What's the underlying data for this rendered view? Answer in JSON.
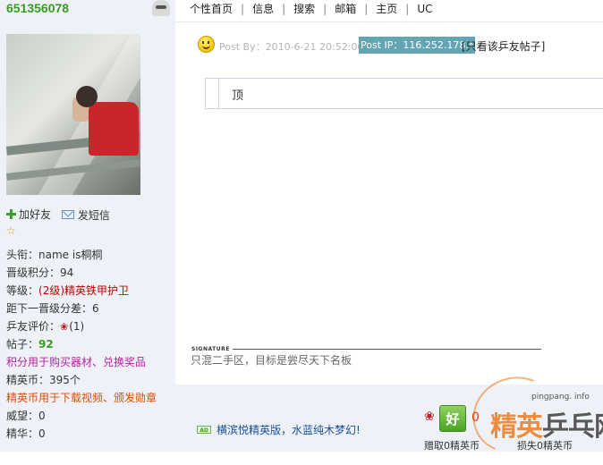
{
  "user": {
    "username": "651356078",
    "add_friend": "加好友",
    "send_message": "发短信",
    "stats": {
      "title_label": "头衔：",
      "title_value": "name is桐桐",
      "points_label": "晋级积分：",
      "points_value": "94",
      "level_label": "等级：",
      "level_value": "(2级)精英铁甲护卫",
      "next_level_label": "距下一晋级分差：",
      "next_level_value": "6",
      "rating_label": "乒友评价：",
      "rating_value": "(1)",
      "posts_label": "帖子：",
      "posts_value": "92",
      "points_note": "积分用于购买器材、兑换奖品",
      "coins_label": "精英币：",
      "coins_value": "395个",
      "coins_note": "精英币用于下载视频、颁发勋章",
      "prestige_label": "威望：",
      "prestige_value": "0",
      "essence_label": "精华：",
      "essence_value": "0"
    }
  },
  "nav": {
    "items": [
      "个性首页",
      "信息",
      "搜索",
      "邮箱",
      "主页",
      "UC"
    ]
  },
  "post": {
    "meta": "Post By：2010-6-21 20:52:00",
    "ip": "Post IP：116.252.178.*",
    "only_this": "[只看该乒友帖子]",
    "content": "顶",
    "signature_label": "SIGNATURE",
    "signature_text": "只混二手区，目标是尝尽天下名板"
  },
  "bottom": {
    "ad_badge": "AD",
    "ad_link": "横滨悦精英版，水蓝纯木梦幻!",
    "good_label": "好",
    "good_count": "0",
    "giving": "赠取0精英币",
    "losing": "损失0精英币"
  },
  "watermark": {
    "domain": "pingpang. info",
    "brand_a": "精英",
    "brand_b": "乒乓网"
  },
  "colors": {
    "username": "#3a9a25",
    "ip_highlight": "#62a6b4",
    "level_red": "#c00000",
    "note_purple": "#b4229e",
    "note_orange": "#dc4a05",
    "ad_link": "#1a4f92",
    "sidebar_bg": "#eef2f8"
  }
}
